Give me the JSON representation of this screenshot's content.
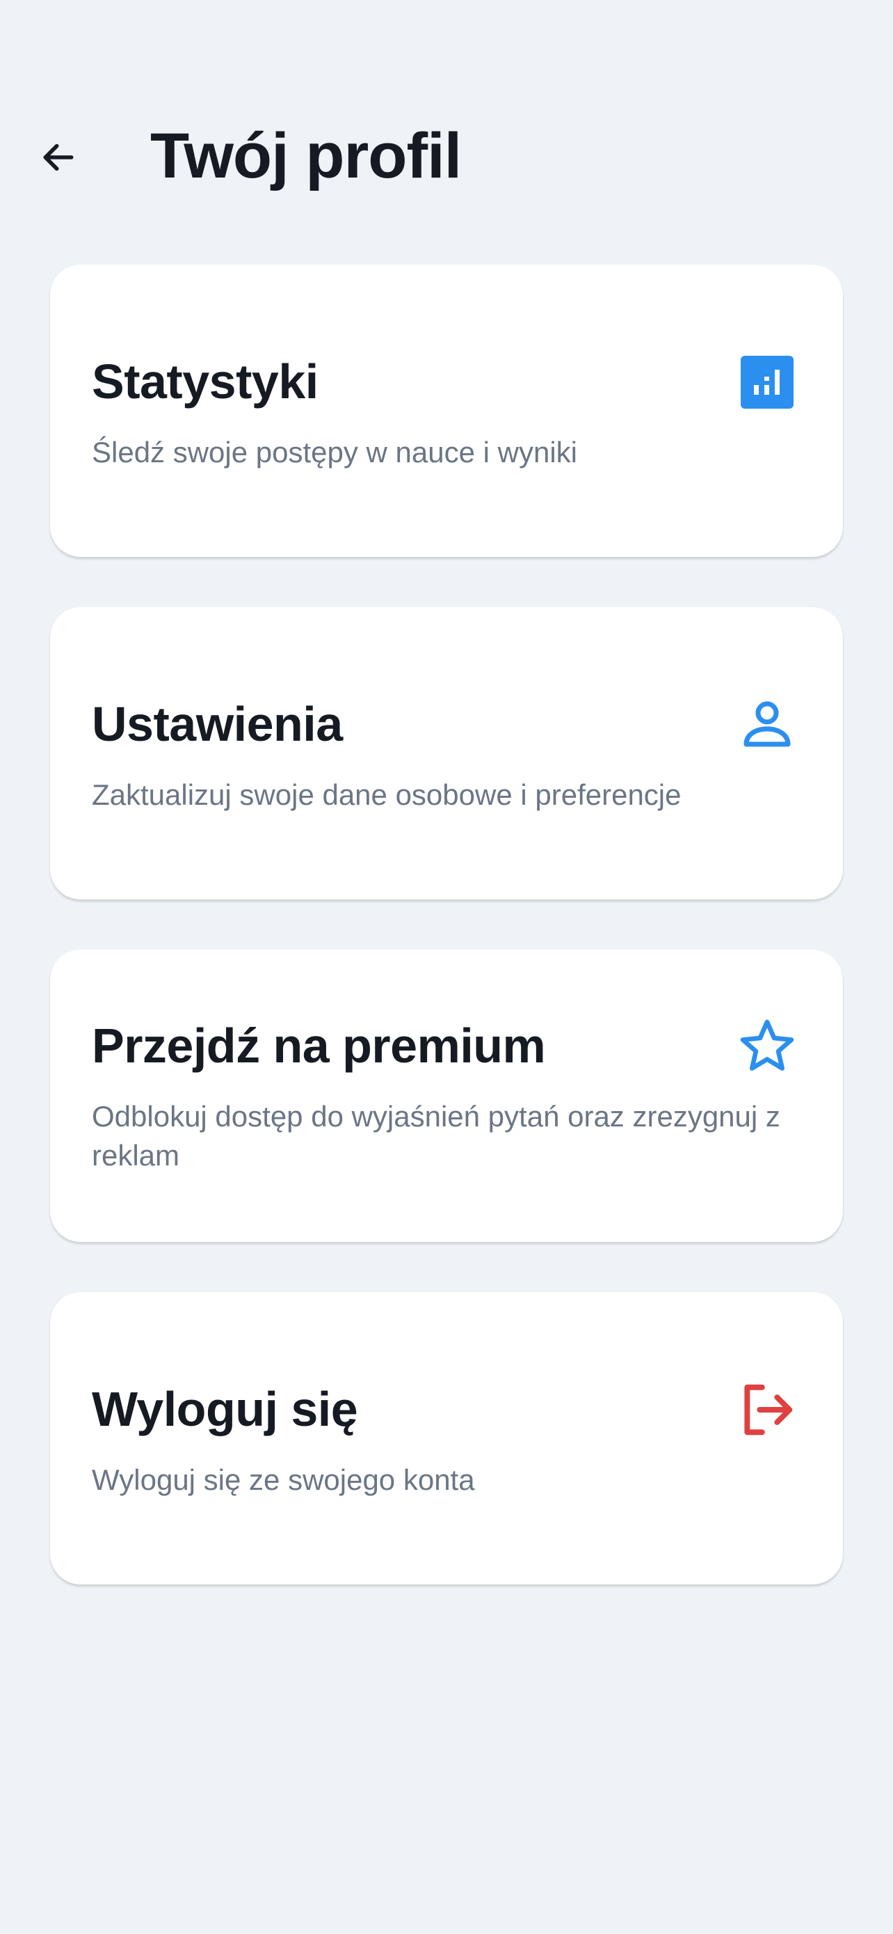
{
  "header": {
    "back_icon": "arrow-left-icon",
    "title": "Twój profil"
  },
  "colors": {
    "background": "#eff3f7",
    "accent_blue": "#2b8ff0",
    "danger_red": "#e04040",
    "title_text": "#161a23",
    "muted_text": "#6b7585"
  },
  "cards": [
    {
      "title": "Statystyki",
      "description": "Śledź swoje postępy w nauce i wyniki",
      "icon": "bar-chart-icon"
    },
    {
      "title": "Ustawienia",
      "description": "Zaktualizuj swoje dane osobowe i preferencje",
      "icon": "user-icon"
    },
    {
      "title": "Przejdź na premium",
      "description": "Odblokuj dostęp do wyjaśnień pytań oraz zrezygnuj z reklam",
      "icon": "star-icon"
    },
    {
      "title": "Wyloguj się",
      "description": "Wyloguj się ze swojego konta",
      "icon": "logout-icon"
    }
  ]
}
